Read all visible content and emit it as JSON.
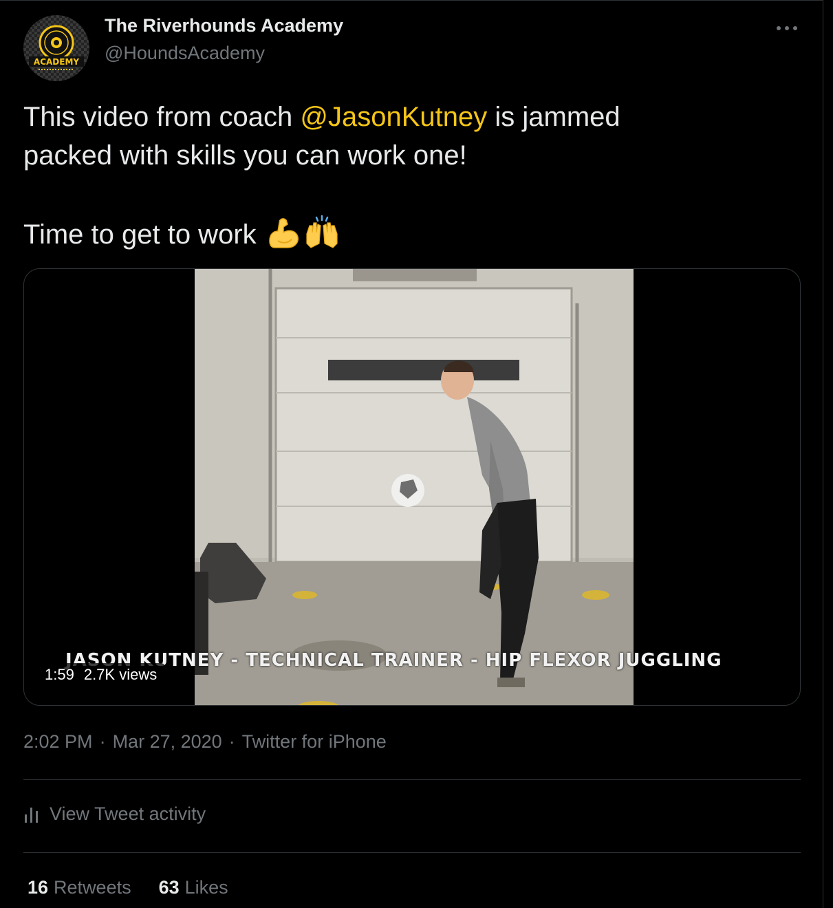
{
  "author": {
    "name": "The Riverhounds Academy",
    "handle": "@HoundsAcademy",
    "avatar_text": "ACADEMY"
  },
  "more_button": {
    "icon": "more-horizontal-icon",
    "label": "···"
  },
  "tweet": {
    "line1_before": "This video from coach ",
    "mention": "@JasonKutney",
    "line1_after": " is jammed",
    "line2": "packed with skills you can work one!",
    "line3": "Time to get to work ",
    "emojis": [
      "flexed-biceps",
      "raising-hands"
    ],
    "mention_color": "#f5c518"
  },
  "video": {
    "caption": "JASON KUTNEY - TECHNICAL TRAINER - HIP FLEXOR JUGGLING",
    "duration": "1:59",
    "views": "2.7K views"
  },
  "timestamp": {
    "time": "2:02 PM",
    "date": "Mar 27, 2020",
    "source": "Twitter for iPhone",
    "separator": "·"
  },
  "activity": {
    "label": "View Tweet activity",
    "icon": "bar-chart-icon"
  },
  "stats": {
    "retweets_count": "16",
    "retweets_label": "Retweets",
    "likes_count": "63",
    "likes_label": "Likes"
  },
  "colors": {
    "background": "#000000",
    "text": "#e7e9ea",
    "secondary": "#71767b",
    "accent": "#f5c518"
  }
}
